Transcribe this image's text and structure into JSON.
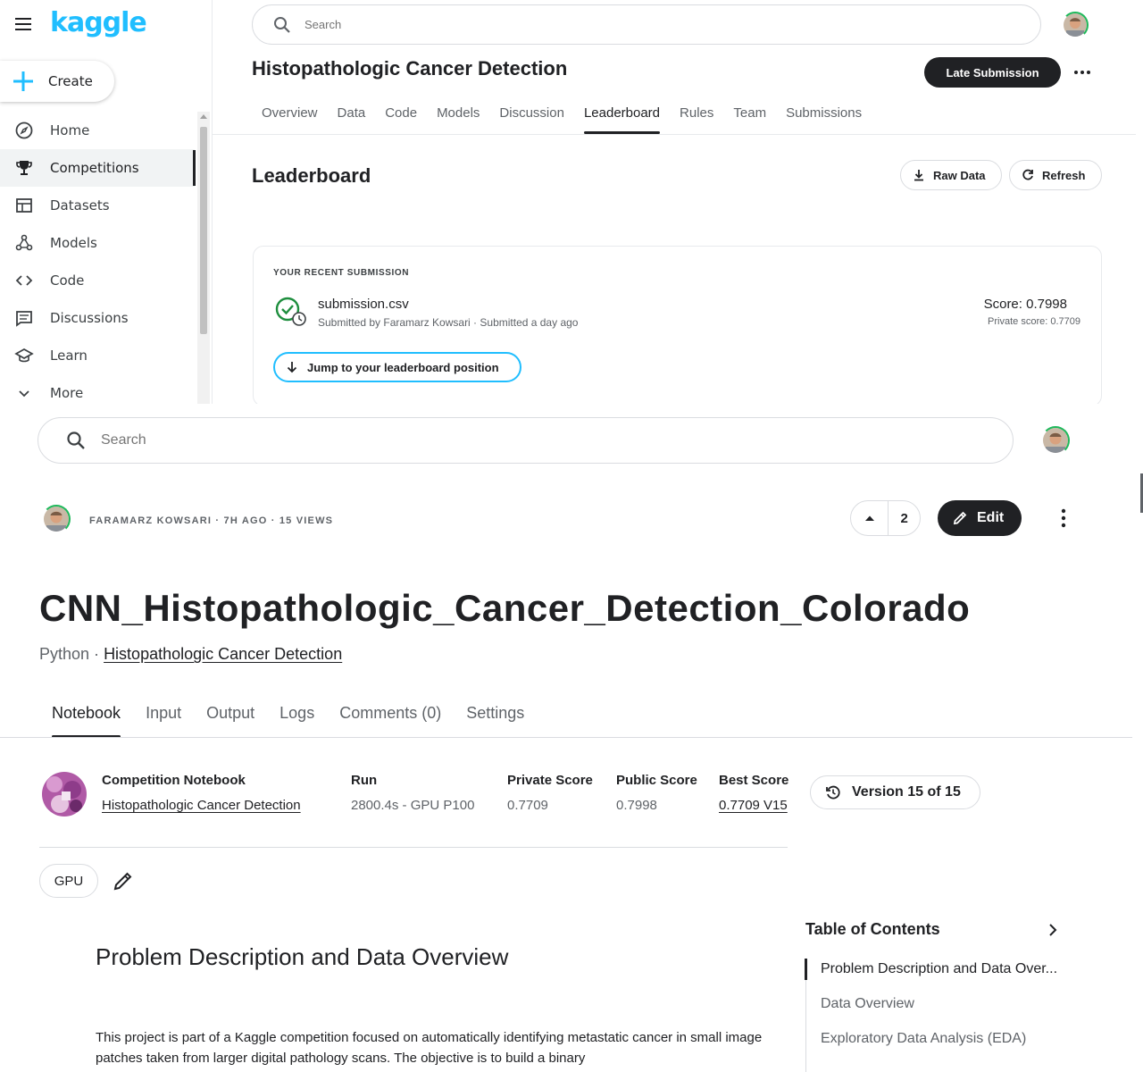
{
  "competition_page": {
    "logo": "kaggle",
    "create_label": "Create",
    "nav": [
      {
        "label": "Home",
        "icon": "compass-icon"
      },
      {
        "label": "Competitions",
        "icon": "trophy-icon",
        "active": true
      },
      {
        "label": "Datasets",
        "icon": "table-icon"
      },
      {
        "label": "Models",
        "icon": "models-icon"
      },
      {
        "label": "Code",
        "icon": "code-icon"
      },
      {
        "label": "Discussions",
        "icon": "discussion-icon"
      },
      {
        "label": "Learn",
        "icon": "graduation-cap-icon"
      },
      {
        "label": "More",
        "icon": "chevron-down-icon"
      }
    ],
    "search_placeholder": "Search",
    "title": "Histopathologic Cancer Detection",
    "late_submission_label": "Late Submission",
    "tabs": [
      "Overview",
      "Data",
      "Code",
      "Models",
      "Discussion",
      "Leaderboard",
      "Rules",
      "Team",
      "Submissions"
    ],
    "active_tab": "Leaderboard",
    "leaderboard_heading": "Leaderboard",
    "raw_data_label": "Raw Data",
    "refresh_label": "Refresh",
    "recent_submission": {
      "section_label": "YOUR RECENT SUBMISSION",
      "file_name": "submission.csv",
      "meta": "Submitted by Faramarz Kowsari · Submitted a day ago",
      "score": "Score: 0.7998",
      "private_score": "Private score: 0.7709",
      "jump_label": "Jump to your leaderboard position"
    }
  },
  "notebook_page": {
    "search_placeholder": "Search",
    "author_line": "FARAMARZ KOWSARI · 7H AGO · 15 VIEWS",
    "vote_count": "2",
    "edit_label": "Edit",
    "title": "CNN_Histopathologic_Cancer_Detection_Colorado",
    "language": "Python ·",
    "competition_link": "Histopathologic Cancer Detection",
    "tabs": [
      "Notebook",
      "Input",
      "Output",
      "Logs",
      "Comments (0)",
      "Settings"
    ],
    "active_tab": "Notebook",
    "meta": {
      "competition_notebook_label": "Competition Notebook",
      "competition_name": "Histopathologic Cancer Detection",
      "run_label": "Run",
      "run_value": "2800.4s - GPU P100",
      "private_score_label": "Private Score",
      "private_score_value": "0.7709",
      "public_score_label": "Public Score",
      "public_score_value": "0.7998",
      "best_score_label": "Best Score",
      "best_score_value": "0.7709 V15"
    },
    "version_label": "Version 15 of 15",
    "accelerator_chip": "GPU",
    "section_heading": "Problem Description and Data Overview",
    "body_text": "This project is part of a Kaggle competition focused on automatically identifying metastatic cancer in small image patches taken from larger digital pathology scans. The objective is to build a binary",
    "toc": {
      "title": "Table of Contents",
      "items": [
        "Problem Description and Data Over...",
        "Data Overview",
        "Exploratory Data Analysis (EDA)"
      ]
    }
  },
  "colors": {
    "kaggle_blue": "#20beff",
    "dark_button": "#202124",
    "success_green": "#1e8e3e",
    "avatar_ring": "#1fb85b"
  }
}
